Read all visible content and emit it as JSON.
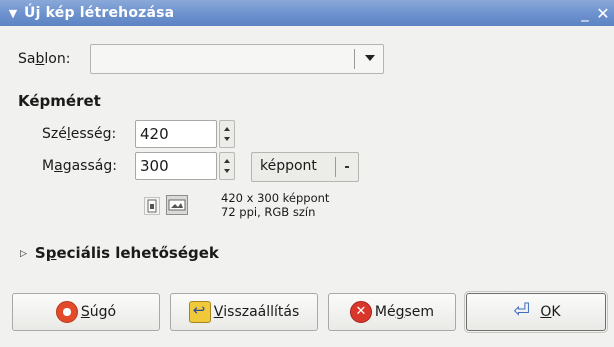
{
  "window": {
    "title": "Új kép létrehozása",
    "minimize_glyph": "_",
    "close_glyph": "✕"
  },
  "template": {
    "label_pre": "Sa",
    "label_mnemonic": "b",
    "label_post": "lon:",
    "value": ""
  },
  "image_size": {
    "section_title": "Képméret",
    "width_label_pre": "Szé",
    "width_label_mnemonic": "l",
    "width_label_post": "esség:",
    "width_value": "420",
    "height_label_pre": "M",
    "height_label_mnemonic": "a",
    "height_label_post": "gasság:",
    "height_value": "300",
    "unit": "képpont",
    "info_line1": "420 x 300 képpont",
    "info_line2": "72 ppi, RGB szín"
  },
  "advanced": {
    "label_pre": "S",
    "label_mnemonic": "p",
    "label_post": "eciális lehetőségek"
  },
  "buttons": {
    "help_mnemonic": "S",
    "help_post": "úgó",
    "reset_mnemonic": "V",
    "reset_post": "isszaállítás",
    "cancel_pre": "Mé",
    "cancel_mnemonic": "g",
    "cancel_post": "sem",
    "ok_mnemonic": "O",
    "ok_post": "K"
  },
  "icons": {
    "menu": "window-menu-icon",
    "portrait": "portrait-orientation-icon",
    "landscape": "landscape-orientation-icon",
    "help": "help-lifebuoy-icon",
    "reset": "reset-icon",
    "cancel": "cancel-icon",
    "ok": "ok-enter-icon"
  }
}
